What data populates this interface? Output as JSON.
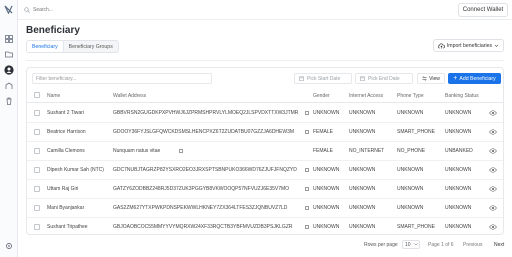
{
  "topbar": {
    "search_placeholder": "Search...",
    "connect_label": "Connect Wallet"
  },
  "page": {
    "title": "Beneficiary"
  },
  "tabs": [
    {
      "label": "Beneficiary",
      "active": true
    },
    {
      "label": "Beneficiary Groups",
      "active": false
    }
  ],
  "actions": {
    "import_label": "Import beneficiaries",
    "new_label": "Add Beneficiary",
    "view_label": "View"
  },
  "filters": {
    "filter_placeholder": "Filter beneficiary...",
    "start_date_placeholder": "Pick Start Date",
    "end_date_placeholder": "Pick End Date"
  },
  "table": {
    "headers": {
      "name": "Name",
      "wallet": "Wallet Address",
      "gender": "Gender",
      "internet": "Internet Access",
      "phone": "Phone Type",
      "banking": "Banking Status"
    },
    "rows": [
      {
        "name": "Sushant 2 Tiwari",
        "wallet": "GBBVRSN2GUGDKPXPVHWJ6JZPRMSHPRVLYLMOEQ2JLSPVDXTTXW3JTMR",
        "gender": "UNKNOWN",
        "internet": "UNKNOWN",
        "phone": "UNKNOWN",
        "banking": "UNKNOWN"
      },
      {
        "name": "Beatrice Harrison",
        "wallet": "GDOOY36FYJSLGFQWCKDSMSLHENCPXZ6T2ZUDATBU07GZZJA6DHEW3M",
        "gender": "FEMALE",
        "internet": "UNKNOWN",
        "phone": "SMART_PHONE",
        "banking": "UNKNOWN"
      },
      {
        "name": "Camilla Clemons",
        "wallet": "Nunquam natus vitae",
        "gender": "FEMALE",
        "internet": "NO_INTERNET",
        "phone": "NO_PHONE",
        "banking": "UNBANKED"
      },
      {
        "name": "Dipesh Kumar Sah (NTC)",
        "wallet": "GDC7NUBJTAGRZP82YSXRO2EO3JRXSPTSBNPUKO366WD76ZJUFJFNQZYD",
        "gender": "UNKNOWN",
        "internet": "UNKNOWN",
        "phone": "UNKNOWN",
        "banking": "UNKNOWN"
      },
      {
        "name": "Uttam Raj Giri",
        "wallet": "GATZY6ZODBBZ248RJ5D37ZUK3PGGYB8VKWOOQP57NFVUZJ6E35V7MO",
        "gender": "UNKNOWN",
        "internet": "UNKNOWN",
        "phone": "UNKNOWN",
        "banking": "UNKNOWN"
      },
      {
        "name": "Mani Byanjankar",
        "wallet": "GAS2ZM627YTXPWKPDNSPEKWWLHKNEY7ZX364LTFES3ZJQNBUVZ7LD",
        "gender": "UNKNOWN",
        "internet": "UNKNOWN",
        "phone": "UNKNOWN",
        "banking": "UNKNOWN"
      },
      {
        "name": "Sushant Tripathee",
        "wallet": "GBJOAOBCOC55MMYYVYMQRXW24XF33RQCTB3YBFMVUZDB3PSJKLGZR",
        "gender": "UNKNOWN",
        "internet": "UNKNOWN",
        "phone": "SMART_PHONE",
        "banking": "UNKNOWN"
      }
    ]
  },
  "pagination": {
    "rows_label": "Rows per page",
    "rows_value": "10",
    "page_label": "Page 1 of 6",
    "previous_label": "Previous",
    "next_label": "Next"
  },
  "colors": {
    "accent": "#1a73e8"
  }
}
